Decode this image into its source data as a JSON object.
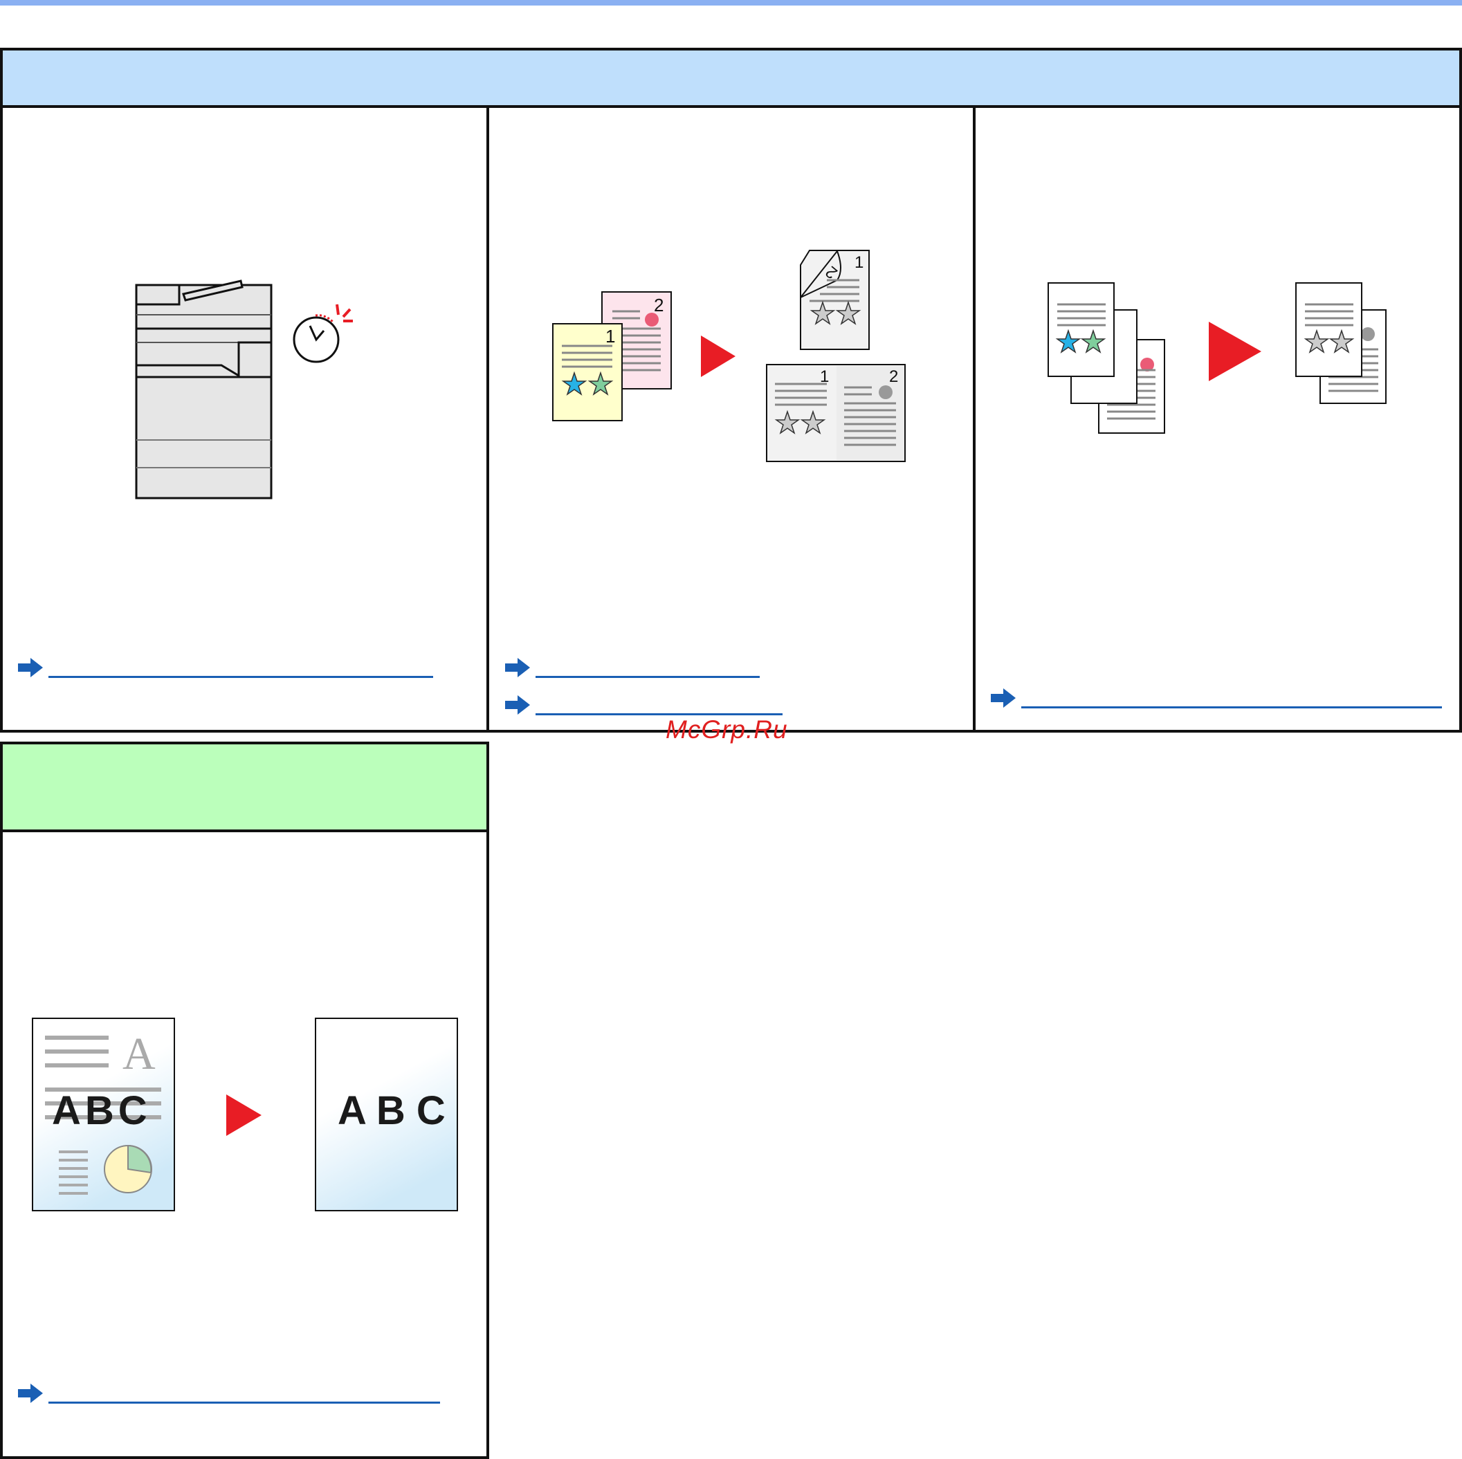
{
  "watermark": "McGrp.Ru",
  "panels": [
    {
      "id": "panel-scheduled",
      "links": [
        ""
      ]
    },
    {
      "id": "panel-duplex",
      "links": [
        "",
        ""
      ]
    },
    {
      "id": "panel-combine",
      "links": [
        ""
      ]
    },
    {
      "id": "panel-text-only",
      "links": [
        ""
      ]
    }
  ],
  "illustrations": {
    "duplex_page_numbers": [
      "1",
      "2",
      "2",
      "1",
      "1",
      "2"
    ],
    "text_sample": "A B C",
    "text_sample_compact": "ABC",
    "serif_letter": "A"
  },
  "colors": {
    "header_blue": "#bfdffc",
    "header_green": "#bbffbb",
    "link_blue": "#1a5fb4",
    "arrow_red": "#e81d25",
    "top_rule": "#8ab0f2"
  }
}
